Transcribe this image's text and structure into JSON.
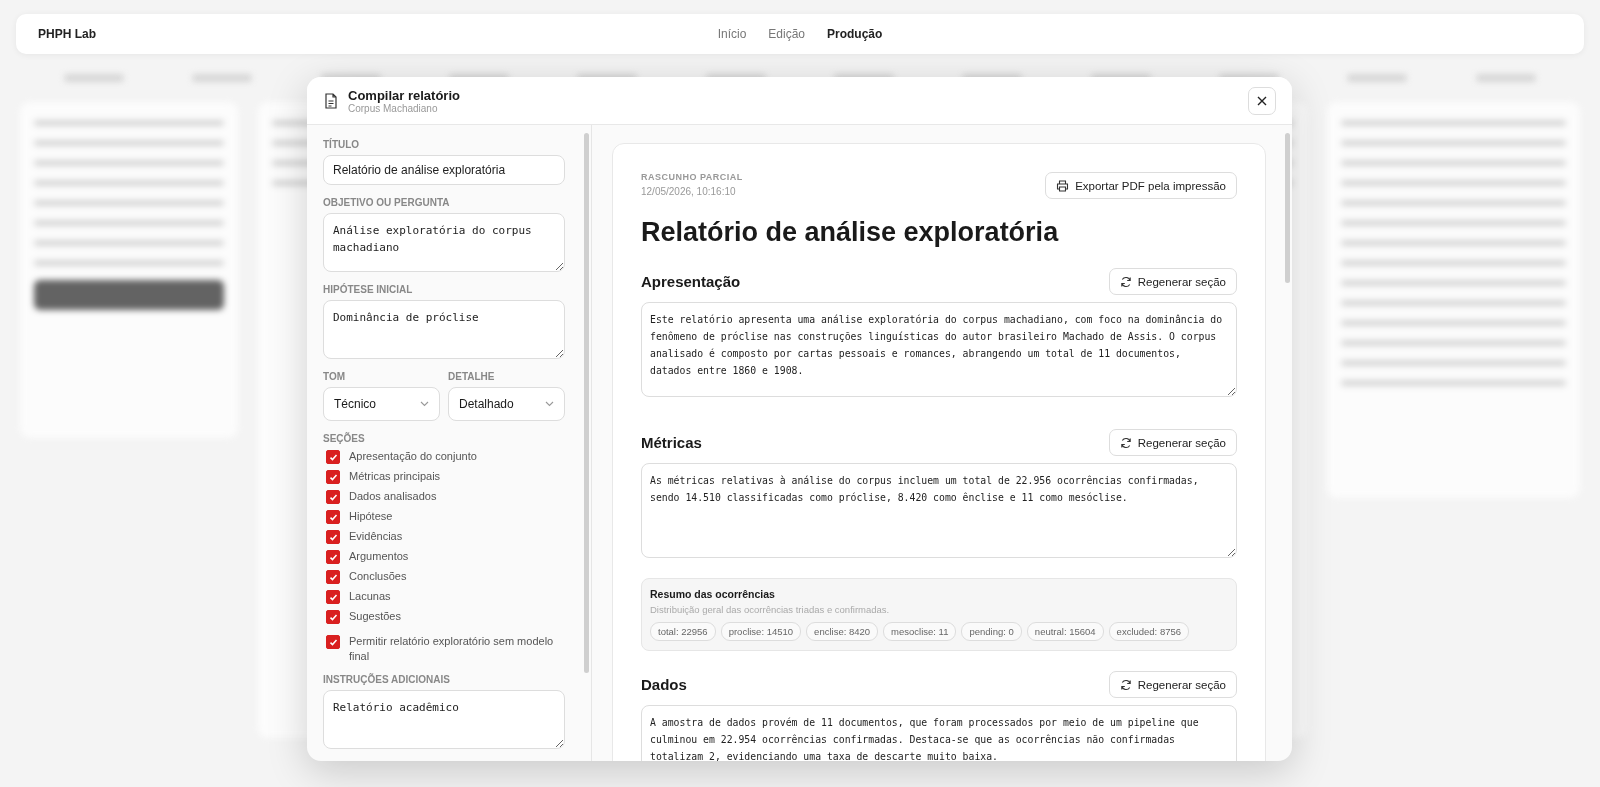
{
  "app": {
    "brand": "PHPH Lab",
    "nav": [
      {
        "label": "Início",
        "selected": false
      },
      {
        "label": "Edição",
        "selected": false
      },
      {
        "label": "Produção",
        "selected": true
      }
    ]
  },
  "modal": {
    "title": "Compilar relatório",
    "subtitle": "Corpus Machadiano",
    "form": {
      "title_label": "TÍTULO",
      "title_value": "Relatório de análise exploratória",
      "objective_label": "OBJETIVO OU PERGUNTA",
      "objective_value": "Análise exploratória do corpus machadiano",
      "hypothesis_label": "HIPÓTESE INICIAL",
      "hypothesis_value": "Dominância de próclise",
      "tone_label": "TOM",
      "tone_value": "Técnico",
      "detail_label": "DETALHE",
      "detail_value": "Detalhado",
      "sections_label": "SEÇÕES",
      "sections": [
        {
          "label": "Apresentação do conjunto",
          "checked": true
        },
        {
          "label": "Métricas principais",
          "checked": true
        },
        {
          "label": "Dados analisados",
          "checked": true
        },
        {
          "label": "Hipótese",
          "checked": true
        },
        {
          "label": "Evidências",
          "checked": true
        },
        {
          "label": "Argumentos",
          "checked": true
        },
        {
          "label": "Conclusões",
          "checked": true
        },
        {
          "label": "Lacunas",
          "checked": true
        },
        {
          "label": "Sugestões",
          "checked": true
        }
      ],
      "allow": {
        "label": "Permitir relatório exploratório sem modelo final",
        "checked": true
      },
      "instructions_label": "INSTRUÇÕES ADICIONAIS",
      "instructions_value": "Relatório acadêmico"
    },
    "report": {
      "status": "RASCUNHO PARCIAL",
      "timestamp": "12/05/2026, 10:16:10",
      "export_button": "Exportar PDF pela impressão",
      "title": "Relatório de análise exploratória",
      "sections": [
        {
          "heading": "Apresentação",
          "button": "Regenerar seção",
          "text": "Este relatório apresenta uma análise exploratória do corpus machadiano, com foco na dominância do fenômeno de próclise nas construções linguísticas do autor brasileiro Machado de Assis. O corpus analisado é composto por cartas pessoais e romances, abrangendo um total de 11 documentos, datados entre 1860 e 1908."
        },
        {
          "heading": "Métricas",
          "button": "Regenerar seção",
          "text": "As métricas relativas à análise do corpus incluem um total de 22.956 ocorrências confirmadas, sendo 14.510 classificadas como próclise, 8.420 como ênclise e 11 como mesóclise.",
          "summary": {
            "title": "Resumo das ocorrências",
            "subtitle": "Distribuição geral das ocorrências triadas e confirmadas.",
            "tags": [
              "total: 22956",
              "proclise: 14510",
              "enclise: 8420",
              "mesoclise: 11",
              "pending: 0",
              "neutral: 15604",
              "excluded: 8756"
            ]
          }
        },
        {
          "heading": "Dados",
          "button": "Regenerar seção",
          "text": "A amostra de dados provém de 11 documentos, que foram processados por meio de um pipeline que culminou em 22.954 ocorrências confirmadas. Destaca-se que as ocorrências não confirmadas totalizam 2, evidenciando uma taxa de descarte muito baixa."
        }
      ]
    }
  }
}
